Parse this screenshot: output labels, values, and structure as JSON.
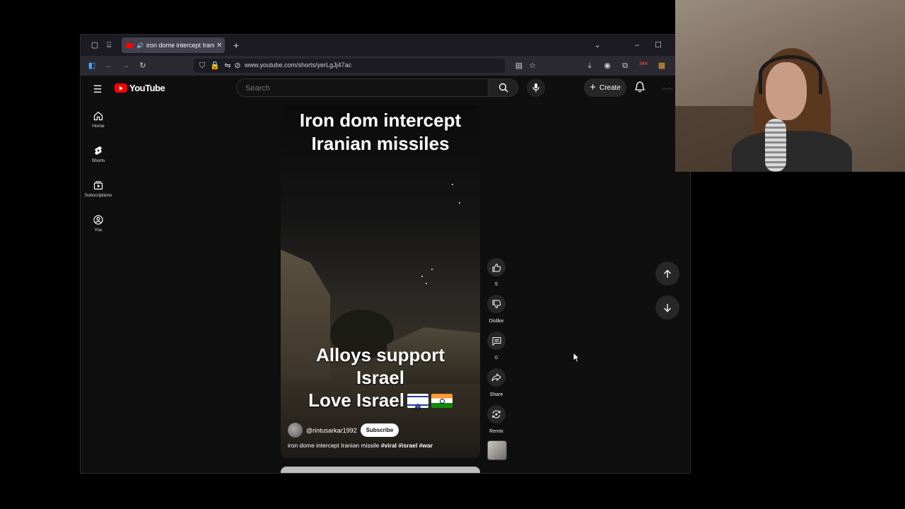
{
  "browser": {
    "tab_title": "iron dome intercept Iranian missiles",
    "url": "www.youtube.com/shorts/yerLgJj47ac",
    "extension_badge": "344"
  },
  "youtube": {
    "logo_text": "YouTube",
    "search_placeholder": "Search",
    "create_label": "Create",
    "sidebar": [
      {
        "label": "Home",
        "icon": "home-icon"
      },
      {
        "label": "Shorts",
        "icon": "shorts-icon"
      },
      {
        "label": "Subscriptions",
        "icon": "subscriptions-icon"
      },
      {
        "label": "You",
        "icon": "you-icon"
      }
    ]
  },
  "short": {
    "title_line1": "Iron dom intercept",
    "title_line2": "Iranian missiles",
    "overlay_line1": "Alloys support",
    "overlay_line2": "Israel",
    "overlay_line3": "Love Israel",
    "channel": "@rintusarkar1992",
    "subscribe_label": "Subscribe",
    "description": "iron dome intercept Iranian missile",
    "hashtags": "#viral #israel #war"
  },
  "actions": {
    "like_count": "5",
    "dislike_label": "Dislike",
    "comment_count": "0",
    "share_label": "Share",
    "remix_label": "Remix"
  },
  "colors": {
    "brand_red": "#ff0000",
    "background": "#0f0f0f"
  }
}
